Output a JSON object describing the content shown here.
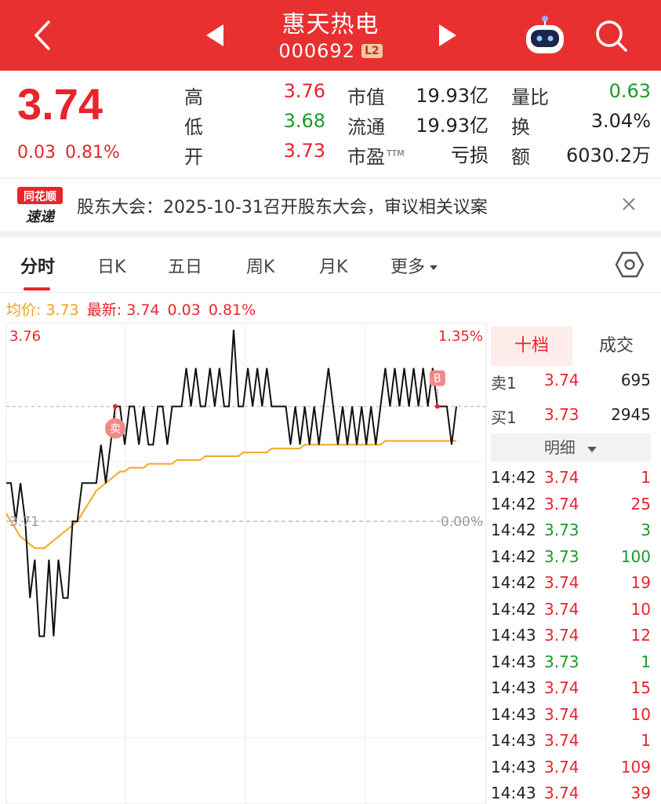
{
  "header": {
    "stock_name": "惠天热电",
    "stock_code": "000692",
    "badge": "L2"
  },
  "quote": {
    "price": "3.74",
    "change": "0.03",
    "change_pct": "0.81%",
    "high_label": "高",
    "high": "3.76",
    "low_label": "低",
    "low": "3.68",
    "open_label": "开",
    "open": "3.73",
    "mcap_label": "市值",
    "mcap": "19.93亿",
    "float_label": "流通",
    "float": "19.93亿",
    "pe_label": "市盈",
    "pe_sup": "TTM",
    "pe": "亏损",
    "vol_ratio_label": "量比",
    "vol_ratio": "0.63",
    "turnover_label": "换",
    "turnover": "3.04%",
    "amount_label": "额",
    "amount": "6030.2万"
  },
  "announcement": {
    "logo_line1": "同花顺",
    "logo_line2": "速递",
    "text": "股东大会：2025-10-31召开股东大会，审议相关议案"
  },
  "tabs": [
    {
      "label": "分时"
    },
    {
      "label": "日K"
    },
    {
      "label": "五日"
    },
    {
      "label": "周K"
    },
    {
      "label": "月K"
    },
    {
      "label": "更多"
    }
  ],
  "info_line": {
    "avg_label": "均价: 3.73",
    "latest_label": "最新: 3.74",
    "change": "0.03",
    "change_pct": "0.81%"
  },
  "chart_data": {
    "type": "line",
    "ylim": [
      3.66,
      3.76
    ],
    "y_top_label": "3.76",
    "y_base_label": "3.71",
    "right_top_label": "1.35%",
    "right_base_label": "0.00%",
    "markers": {
      "buy_label": "B",
      "sell_label": "卖"
    },
    "series": [
      {
        "role": "price",
        "color": "#111111",
        "values": [
          3.72,
          3.72,
          3.71,
          3.72,
          3.71,
          3.69,
          3.7,
          3.68,
          3.68,
          3.7,
          3.68,
          3.7,
          3.69,
          3.69,
          3.71,
          3.71,
          3.72,
          3.72,
          3.72,
          3.72,
          3.73,
          3.72,
          3.73,
          3.74,
          3.74,
          3.73,
          3.74,
          3.74,
          3.73,
          3.74,
          3.73,
          3.73,
          3.74,
          3.74,
          3.73,
          3.74,
          3.74,
          3.74,
          3.75,
          3.74,
          3.75,
          3.74,
          3.74,
          3.75,
          3.74,
          3.75,
          3.74,
          3.74,
          3.76,
          3.74,
          3.74,
          3.75,
          3.74,
          3.75,
          3.74,
          3.75,
          3.74,
          3.74,
          3.74,
          3.74,
          3.73,
          3.74,
          3.73,
          3.74,
          3.73,
          3.74,
          3.73,
          3.74,
          3.75,
          3.74,
          3.73,
          3.74,
          3.73,
          3.74,
          3.73,
          3.74,
          3.73,
          3.74,
          3.73,
          3.74,
          3.75,
          3.74,
          3.75,
          3.74,
          3.75,
          3.74,
          3.75,
          3.74,
          3.75,
          3.74,
          3.75,
          3.74,
          3.74,
          3.74,
          3.73,
          3.74
        ]
      },
      {
        "role": "average",
        "color": "#f5a623",
        "values": [
          3.712,
          3.71,
          3.708,
          3.706,
          3.705,
          3.704,
          3.703,
          3.703,
          3.703,
          3.704,
          3.705,
          3.706,
          3.707,
          3.708,
          3.709,
          3.71,
          3.712,
          3.714,
          3.716,
          3.718,
          3.719,
          3.72,
          3.721,
          3.722,
          3.723,
          3.723,
          3.724,
          3.724,
          3.724,
          3.724,
          3.725,
          3.725,
          3.725,
          3.725,
          3.725,
          3.725,
          3.726,
          3.726,
          3.726,
          3.726,
          3.726,
          3.726,
          3.727,
          3.727,
          3.727,
          3.727,
          3.727,
          3.727,
          3.727,
          3.727,
          3.728,
          3.728,
          3.728,
          3.728,
          3.728,
          3.728,
          3.729,
          3.729,
          3.729,
          3.729,
          3.729,
          3.729,
          3.729,
          3.73,
          3.73,
          3.73,
          3.73,
          3.73,
          3.73,
          3.73,
          3.73,
          3.73,
          3.73,
          3.73,
          3.73,
          3.73,
          3.73,
          3.73,
          3.73,
          3.73,
          3.731,
          3.731,
          3.731,
          3.731,
          3.731,
          3.731,
          3.731,
          3.731,
          3.731,
          3.731,
          3.731,
          3.731,
          3.731,
          3.731,
          3.731,
          3.731
        ]
      }
    ]
  },
  "orderbook": {
    "tab_active": "十档",
    "tab_inactive": "成交",
    "rows": [
      {
        "label": "卖1",
        "price": "3.74",
        "volume": "695"
      },
      {
        "label": "买1",
        "price": "3.73",
        "volume": "2945"
      }
    ],
    "detail_label": "明细"
  },
  "ticks": [
    {
      "time": "14:42",
      "price": "3.74",
      "volume": "1",
      "dir": "up"
    },
    {
      "time": "14:42",
      "price": "3.74",
      "volume": "25",
      "dir": "up"
    },
    {
      "time": "14:42",
      "price": "3.73",
      "volume": "3",
      "dir": "down"
    },
    {
      "time": "14:42",
      "price": "3.73",
      "volume": "100",
      "dir": "down"
    },
    {
      "time": "14:42",
      "price": "3.74",
      "volume": "19",
      "dir": "up"
    },
    {
      "time": "14:42",
      "price": "3.74",
      "volume": "10",
      "dir": "up"
    },
    {
      "time": "14:43",
      "price": "3.74",
      "volume": "12",
      "dir": "up"
    },
    {
      "time": "14:43",
      "price": "3.73",
      "volume": "1",
      "dir": "down"
    },
    {
      "time": "14:43",
      "price": "3.74",
      "volume": "15",
      "dir": "up"
    },
    {
      "time": "14:43",
      "price": "3.74",
      "volume": "10",
      "dir": "up"
    },
    {
      "time": "14:43",
      "price": "3.74",
      "volume": "1",
      "dir": "up"
    },
    {
      "time": "14:43",
      "price": "3.74",
      "volume": "109",
      "dir": "up"
    },
    {
      "time": "14:43",
      "price": "3.74",
      "volume": "39",
      "dir": "up"
    }
  ],
  "colors": {
    "header_bg": "#e93030",
    "up": "#e8242c",
    "down": "#1a9a2c",
    "avg_line": "#f5a623"
  },
  "icons": [
    "back-arrow-icon",
    "prev-stock-icon",
    "next-stock-icon",
    "robot-assistant-icon",
    "search-icon",
    "close-icon",
    "settings-hexagon-icon",
    "dropdown-caret-icon"
  ]
}
